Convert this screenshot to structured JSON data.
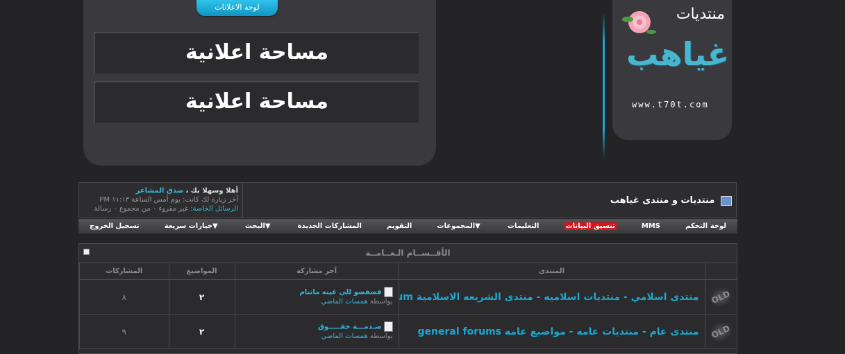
{
  "header": {
    "ad_tab": "لوحة الاعلانات",
    "ad_space_1": "مساحة اعلانية",
    "ad_space_2": "مساحة اعلانية",
    "logo_top": "منتديات",
    "logo_main": "غياهب",
    "logo_url": "www.t70t.com"
  },
  "welcome": {
    "greeting": "أهلا وسهلا بك ،",
    "username": "صدق المشاعر",
    "last_visit": "آخر زيارة لك كانت: يوم أمس الساعة ١١:١٣ PM",
    "pm_label": "الرسائل الخاصة:",
    "pm_value": "غير مقروء ٠ من مجموع ٠ رسالة",
    "forum_title": "منتديات و منتدى غياهب"
  },
  "navbar": {
    "items": [
      {
        "label": "لوحة التحكم"
      },
      {
        "label": "MMS"
      },
      {
        "label": "تنسيق البيانات"
      },
      {
        "label": "التعليمات"
      },
      {
        "label": "المجموعات"
      },
      {
        "label": "التقويم"
      },
      {
        "label": "المشاركات الجديدة"
      },
      {
        "label": "البحث"
      },
      {
        "label": "خيارات سريعة"
      },
      {
        "label": "تسجيل الخروج"
      }
    ]
  },
  "category": {
    "title": "الأقــســام الـعــامــة",
    "columns": {
      "forum": "المنتدى",
      "last_post": "آخر مشاركة",
      "threads": "المواضيع",
      "posts": "المشاركات"
    },
    "rows": [
      {
        "status": "OLD",
        "name": "منتدى اسلامي - منتديات اسلاميه - منتدى الشريعه الاسلامية islamic forum",
        "last_title": "فضفضو للي عينه ماتنام",
        "by_label": "بواسطة",
        "last_user": "همسات الماضي",
        "threads": "٢",
        "posts": "٨"
      },
      {
        "status": "OLD",
        "name": "منتدى عام - منتديات عامه - مواضيع عامه general forums",
        "last_title": "صـدمـــة خفـــــوق",
        "by_label": "بواسطة",
        "last_user": "همسات الماضي",
        "threads": "٢",
        "posts": "٩"
      }
    ]
  },
  "colors": {
    "background": "#242427",
    "accent": "#1ca7d0",
    "highlight": "#d8141c"
  }
}
